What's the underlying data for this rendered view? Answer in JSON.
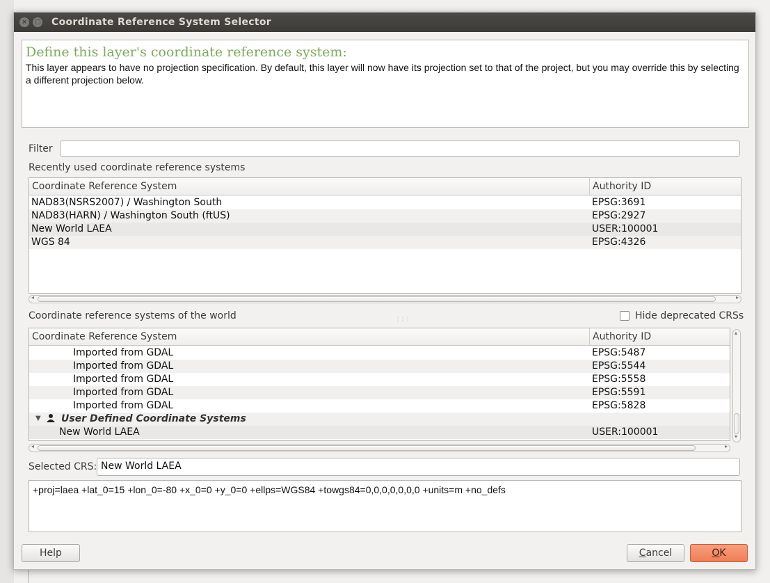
{
  "window": {
    "title": "Coordinate Reference System Selector",
    "close_glyph": "×",
    "maximize_glyph": "□"
  },
  "info": {
    "heading": "Define this layer's coordinate reference system:",
    "text": "This layer appears to have no projection specification. By default, this layer will now have its projection set to that of the project, but you may override this by selecting a different projection below."
  },
  "filter": {
    "label": "Filter",
    "value": "",
    "placeholder": ""
  },
  "recent": {
    "label": "Recently used coordinate reference systems",
    "columns": [
      "Coordinate Reference System",
      "Authority ID"
    ],
    "rows": [
      {
        "name": "NAD83(NSRS2007) / Washington South",
        "id": "EPSG:3691"
      },
      {
        "name": "NAD83(HARN) / Washington South (ftUS)",
        "id": "EPSG:2927"
      },
      {
        "name": "New World LAEA",
        "id": "USER:100001"
      },
      {
        "name": "WGS 84",
        "id": "EPSG:4326"
      }
    ]
  },
  "world": {
    "label": "Coordinate reference systems of the world",
    "hide_deprecated_label": "Hide deprecated CRSs",
    "hide_deprecated_checked": false,
    "columns": [
      "Coordinate Reference System",
      "Authority ID"
    ],
    "rows": [
      {
        "name": "Imported from GDAL",
        "id": "EPSG:5487"
      },
      {
        "name": "Imported from GDAL",
        "id": "EPSG:5544"
      },
      {
        "name": "Imported from GDAL",
        "id": "EPSG:5558"
      },
      {
        "name": "Imported from GDAL",
        "id": "EPSG:5591"
      },
      {
        "name": "Imported from GDAL",
        "id": "EPSG:5828"
      }
    ],
    "group": {
      "name": "User Defined Coordinate Systems",
      "expanded": true
    },
    "group_rows": [
      {
        "name": "New World LAEA",
        "id": "USER:100001"
      }
    ]
  },
  "selected": {
    "label": "Selected CRS:",
    "value": "New World LAEA",
    "proj": "+proj=laea +lat_0=15 +lon_0=-80 +x_0=0 +y_0=0 +ellps=WGS84 +towgs84=0,0,0,0,0,0,0 +units=m +no_defs"
  },
  "buttons": {
    "help": "Help",
    "cancel_accel": "C",
    "cancel_rest": "ancel",
    "ok_accel": "O",
    "ok_rest": "K"
  },
  "colors": {
    "heading": "#7daa5a",
    "ok_button": "#ef7e57",
    "titlebar": "#3c3b37"
  },
  "icons": {
    "expand": "chevron-down-icon",
    "group": "user-icon"
  }
}
